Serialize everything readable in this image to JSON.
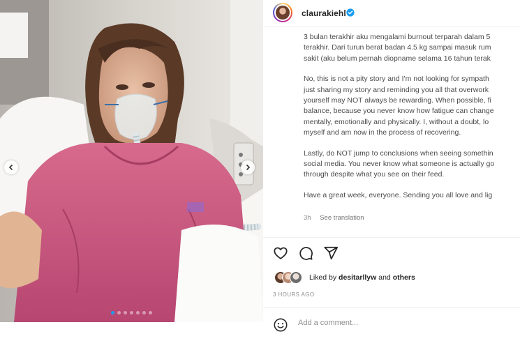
{
  "post": {
    "username": "claurakiehl",
    "caption_lines_p1": [
      "3 bulan terakhir aku mengalami burnout terparah dalam 5",
      "terakhir. Dari turun berat badan 4.5 kg sampai masuk rum",
      "sakit (aku belum pernah diopname selama 16 tahun terak"
    ],
    "caption_lines_p2": [
      "No, this is not a pity story and I'm not looking for sympath",
      "just sharing my story and reminding you all that overwork",
      "yourself may NOT always be rewarding. When possible, fi",
      "balance, because you never know how fatigue can change",
      "mentally, emotionally and physically. I, without a doubt, lo",
      "myself and am now in the process of recovering."
    ],
    "caption_lines_p3": [
      "Lastly, do NOT jump to conclusions when seeing somethin",
      "social media. You never know what someone is actually go",
      "through despite what you see on their feed."
    ],
    "caption_lines_p4": [
      "Have a great week, everyone. Sending you all love and lig"
    ],
    "time_ago": "3h",
    "see_translation": "See translation",
    "liked_by_prefix": "Liked by",
    "liked_by_user": "desitarllyw",
    "liked_by_and": "and",
    "liked_by_others": "others",
    "posted_ago": "3 HOURS AGO",
    "comment_placeholder": "Add a comment...",
    "carousel": {
      "total": 7,
      "active_index": 0
    },
    "icons": {
      "header": [
        "verified-badge-icon"
      ],
      "actions": [
        "heart-icon",
        "comment-icon",
        "share-icon"
      ],
      "composer": [
        "emoji-icon"
      ],
      "carousel": [
        "chevron-left-icon",
        "chevron-right-icon"
      ]
    },
    "colors": {
      "verified": "#1a9df0",
      "carousel_dot_active": "#1a9df0",
      "gown": "#c9527a"
    }
  }
}
